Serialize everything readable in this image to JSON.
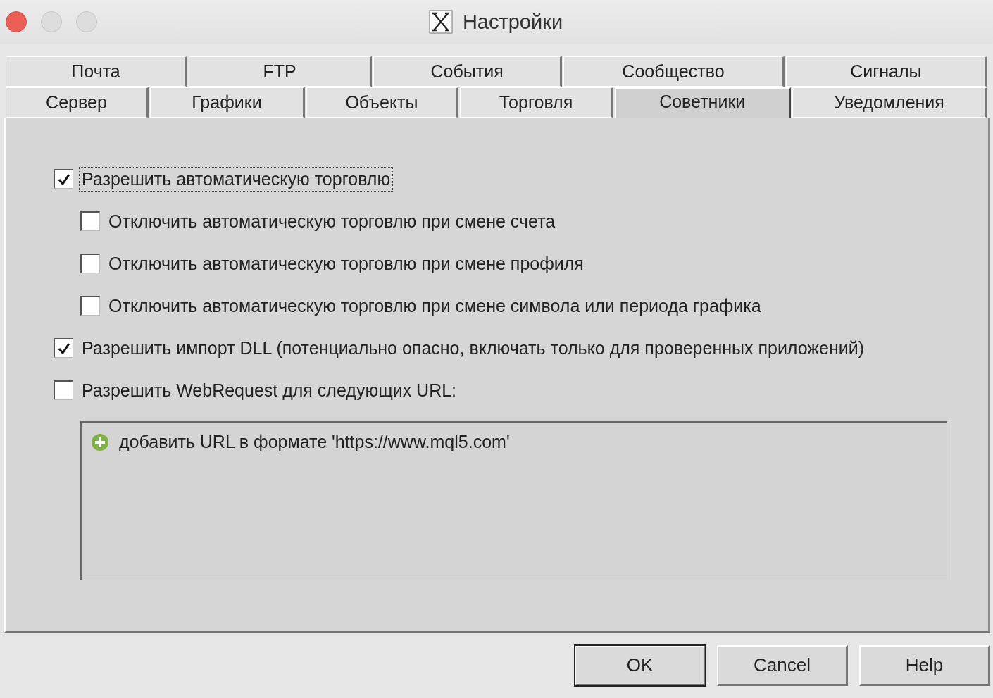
{
  "window": {
    "title": "Настройки"
  },
  "tab_rows": [
    {
      "tabs": [
        {
          "label": "Почта",
          "selected": false
        },
        {
          "label": "FTP",
          "selected": false
        },
        {
          "label": "События",
          "selected": false
        },
        {
          "label": "Сообщество",
          "selected": false
        },
        {
          "label": "Сигналы",
          "selected": false
        }
      ]
    },
    {
      "tabs": [
        {
          "label": "Сервер",
          "selected": false
        },
        {
          "label": "Графики",
          "selected": false
        },
        {
          "label": "Объекты",
          "selected": false
        },
        {
          "label": "Торговля",
          "selected": false
        },
        {
          "label": "Советники",
          "selected": true
        },
        {
          "label": "Уведомления",
          "selected": false
        }
      ]
    }
  ],
  "options": [
    {
      "label": "Разрешить автоматическую торговлю",
      "checked": true,
      "focused": true,
      "children": [
        {
          "label": "Отключить автоматическую торговлю при смене счета",
          "checked": false,
          "focused": false
        },
        {
          "label": "Отключить автоматическую торговлю при смене профиля",
          "checked": false,
          "focused": false
        },
        {
          "label": "Отключить автоматическую торговлю при смене символа или периода графика",
          "checked": false,
          "focused": false
        }
      ]
    },
    {
      "label": "Разрешить импорт DLL (потенциально опасно, включать только для проверенных приложений)",
      "checked": true,
      "focused": false
    },
    {
      "label": "Разрешить WebRequest для следующих URL:",
      "checked": false,
      "focused": false
    }
  ],
  "url_list": {
    "items": [
      {
        "kind": "add",
        "text": "добавить URL в формате 'https://www.mql5.com'"
      }
    ]
  },
  "buttons": [
    {
      "label": "OK",
      "default": true
    },
    {
      "label": "Cancel",
      "default": false
    },
    {
      "label": "Help",
      "default": false
    }
  ]
}
